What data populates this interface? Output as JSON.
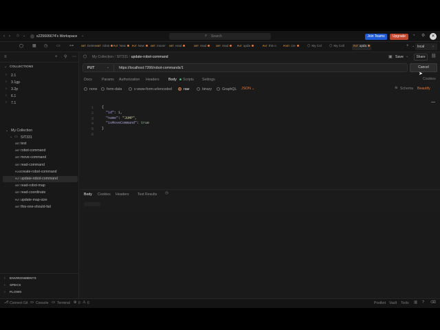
{
  "titlebar": {
    "workspace_label": "s225606674's Workspace",
    "search_placeholder": "Search",
    "join_teams_label": "Join Teams",
    "upgrade_label": "Upgrade",
    "colors": {
      "join": "#1f5bd6",
      "upgrade": "#c2452d"
    }
  },
  "tabs": [
    {
      "method": "GET",
      "label": "Delete",
      "dot": false
    },
    {
      "method": "GET",
      "label": "robot",
      "dot": true
    },
    {
      "method": "PUT",
      "label": "New",
      "dot": true
    },
    {
      "method": "PUT",
      "label": "New",
      "dot": true
    },
    {
      "method": "GET",
      "label": "mover",
      "dot": false
    },
    {
      "method": "GET",
      "label": "read",
      "dot": true
    },
    {
      "method": "GET",
      "label": "read",
      "dot": true
    },
    {
      "method": "GET",
      "label": "read",
      "dot": true
    },
    {
      "method": "PUT",
      "label": "upda",
      "dot": true
    },
    {
      "method": "PUT",
      "label": "this o",
      "dot": false
    },
    {
      "method": "POST",
      "label": "cre",
      "dot": true
    },
    {
      "method": "",
      "label": "My Col",
      "dot": false
    },
    {
      "method": "",
      "label": "My Coll",
      "dot": false
    },
    {
      "method": "PUT",
      "label": "upda",
      "dot": true
    }
  ],
  "env_select": "local",
  "sidebar": {
    "section_collections": "COLLECTIONS",
    "folders": [
      "2.1",
      "3.1gp",
      "3.2p",
      "6.1",
      "7.1"
    ],
    "my_collection": "My Collection",
    "sit_folder": "SIT331",
    "requests": [
      {
        "method": "GET",
        "name": "test"
      },
      {
        "method": "GET",
        "name": "robot-command"
      },
      {
        "method": "GET",
        "name": "move-command"
      },
      {
        "method": "GET",
        "name": "read-command"
      },
      {
        "method": "POST",
        "name": "create-robot-command"
      },
      {
        "method": "PUT",
        "name": "update-robot-command"
      },
      {
        "method": "GET",
        "name": "read-robot-map"
      },
      {
        "method": "GET",
        "name": "read-coordinate"
      },
      {
        "method": "PUT",
        "name": "update-map-size"
      },
      {
        "method": "GET",
        "name": "this-one-should-fail"
      }
    ],
    "bottom_sections": [
      "ENVIRONMENTS",
      "SPECS",
      "FLOWS"
    ]
  },
  "breadcrumb": {
    "collection": "My Collection",
    "folder": "SIT331",
    "request": "update-robot-command"
  },
  "save_label": "Save",
  "share_label": "Share",
  "request": {
    "method": "PUT",
    "url": "https://localhost:7266/robot-commands/1",
    "send_label": "Cancel"
  },
  "req_tabs": [
    "Docs",
    "Params",
    "Authorization",
    "Headers",
    "Body",
    "Scripts",
    "Settings"
  ],
  "req_tab_active": "Body",
  "cookies_label": "Cookies",
  "body_types": [
    "none",
    "form-data",
    "x-www-form-urlencoded",
    "raw",
    "binary",
    "GraphQL"
  ],
  "body_type_selected": "raw",
  "raw_format": "JSON",
  "schema_label": "Schema",
  "beautify_label": "Beautify",
  "code_lines": [
    {
      "n": "1",
      "parts": [
        {
          "t": "{",
          "c": ""
        }
      ]
    },
    {
      "n": "2",
      "parts": [
        {
          "t": "  \"id\"",
          "c": "key"
        },
        {
          "t": ": ",
          "c": ""
        },
        {
          "t": "1",
          "c": "num"
        },
        {
          "t": ",",
          "c": ""
        }
      ]
    },
    {
      "n": "3",
      "parts": [
        {
          "t": "  \"name\"",
          "c": "key"
        },
        {
          "t": ": ",
          "c": ""
        },
        {
          "t": "\"JUMP\"",
          "c": "str"
        },
        {
          "t": ",",
          "c": ""
        }
      ]
    },
    {
      "n": "4",
      "parts": [
        {
          "t": "  \"isMoveCommand\"",
          "c": "key"
        },
        {
          "t": ": ",
          "c": ""
        },
        {
          "t": "true",
          "c": "num"
        }
      ]
    },
    {
      "n": "5",
      "parts": [
        {
          "t": "}",
          "c": ""
        }
      ]
    },
    {
      "n": "6",
      "parts": []
    }
  ],
  "resp_tabs": [
    "Body",
    "Cookies",
    "Headers",
    "Test Results"
  ],
  "resp_tab_active": "Body",
  "statusbar": {
    "left": [
      "Connect Git",
      "Console",
      "Terminal"
    ],
    "errors": "0",
    "warnings": "0",
    "right": [
      "Postbot",
      "Vault",
      "Tools"
    ]
  }
}
